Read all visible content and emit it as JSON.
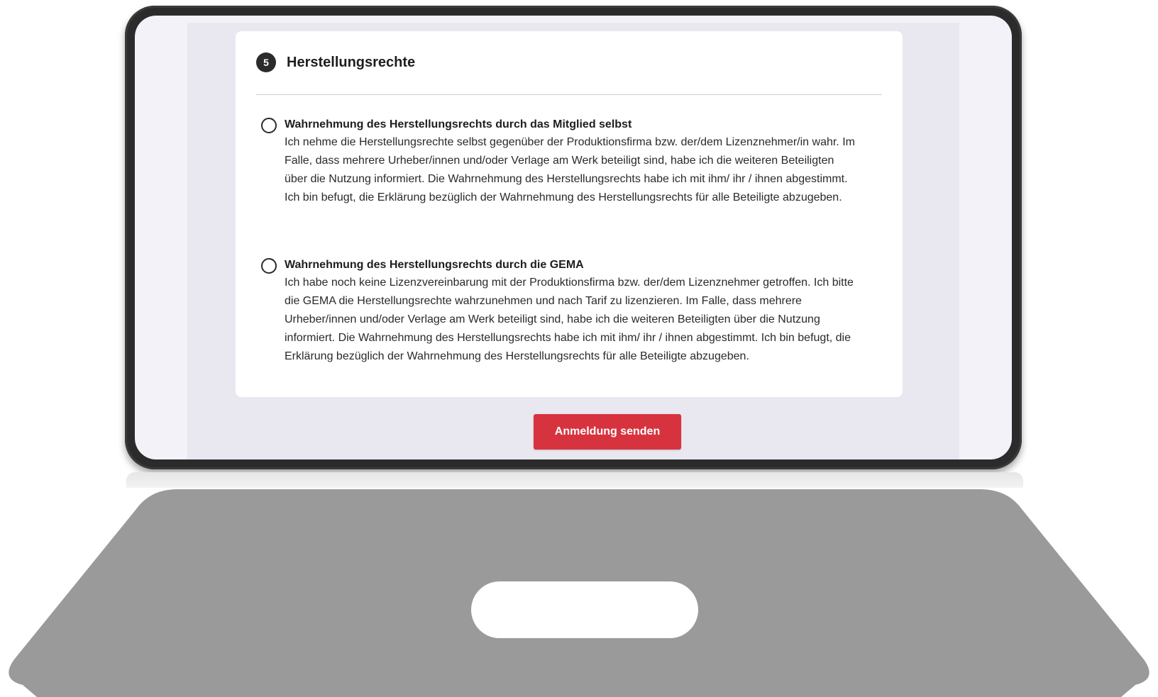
{
  "section": {
    "step_number": "5",
    "title": "Herstellungsrechte"
  },
  "options": [
    {
      "title": "Wahrnehmung des Herstellungsrechts durch das Mitglied selbst",
      "description": "Ich nehme die Herstellungsrechte selbst gegenüber der Produktionsfirma bzw. der/dem Lizenznehmer/in wahr. Im Falle, dass mehrere Urheber/innen und/oder Verlage am Werk beteiligt sind, habe ich die weiteren Beteiligten über die Nutzung informiert. Die Wahrnehmung des Herstellungsrechts habe ich mit ihm/ ihr / ihnen abgestimmt. Ich bin befugt, die Erklärung bezüglich der Wahrnehmung des Herstellungsrechts für alle Beteiligte abzugeben.",
      "selected": false
    },
    {
      "title": "Wahrnehmung des Herstellungsrechts durch die GEMA",
      "description": "Ich habe noch keine Lizenzvereinbarung mit der Produktionsfirma bzw. der/dem Lizenznehmer getroffen. Ich bitte die GEMA die Herstellungsrechte wahrzunehmen und nach Tarif zu lizenzieren. Im Falle, dass mehrere Urheber/innen und/oder Verlage am Werk beteiligt sind, habe ich die weiteren Beteiligten über die Nutzung informiert. Die Wahrnehmung des Herstellungsrechts habe ich mit ihm/ ihr / ihnen abgestimmt. Ich bin befugt, die Erklärung bezüglich der Wahrnehmung des Herstellungsrechts für alle Beteiligte abzugeben.",
      "selected": false
    }
  ],
  "submit": {
    "label": "Anmeldung senden"
  },
  "colors": {
    "accent": "#d7333f",
    "frame": "#2b2b2b",
    "base": "#9a9a9a"
  }
}
